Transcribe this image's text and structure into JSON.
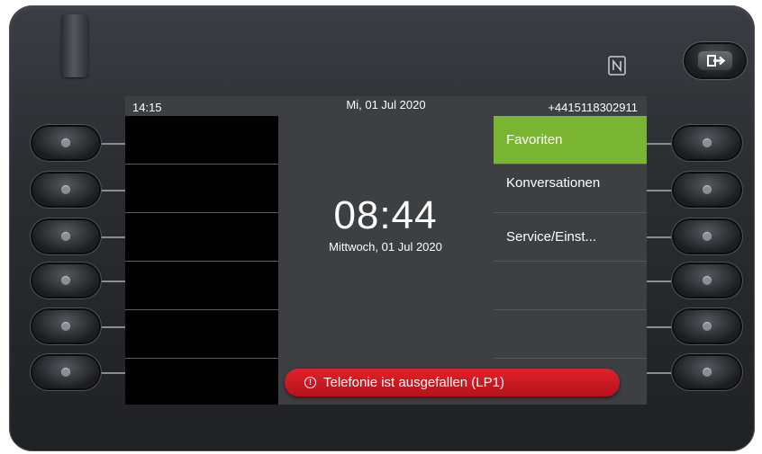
{
  "status_bar": {
    "time": "14:15",
    "date": "Mi, 01 Jul 2020",
    "number": "+4415118302911"
  },
  "idle_screen": {
    "clock": "08:44",
    "date_long": "Mittwoch, 01 Jul 2020"
  },
  "menu": [
    {
      "label": "Favoriten",
      "active": true
    },
    {
      "label": "Konversationen",
      "active": false
    },
    {
      "label": "Service/Einst...",
      "active": false
    },
    {
      "label": "",
      "active": false
    },
    {
      "label": "",
      "active": false
    },
    {
      "label": "",
      "active": false
    }
  ],
  "alert": {
    "icon": "warning-icon",
    "message": "Telefonie ist ausgefallen (LP1)"
  },
  "colors": {
    "active_menu": "#79b530",
    "alert_red": "#d81b24"
  },
  "icons": {
    "nfc": "nfc-icon",
    "logout": "logout-icon"
  }
}
